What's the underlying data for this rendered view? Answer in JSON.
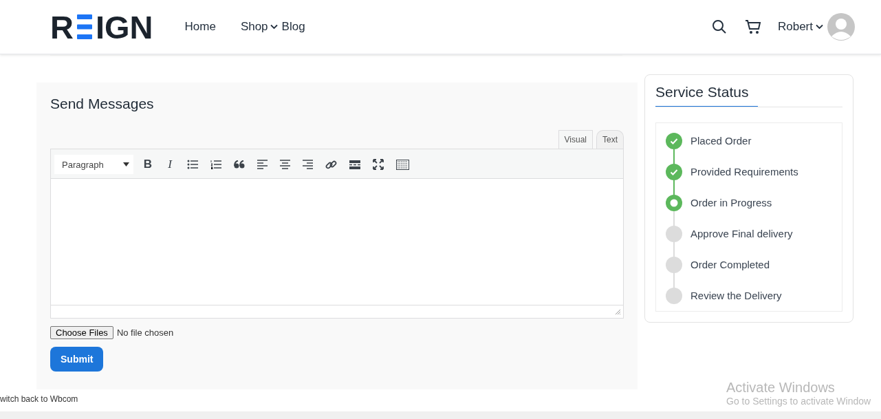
{
  "logo": {
    "before": "R",
    "after": "IGN"
  },
  "nav": [
    {
      "label": "Home",
      "dropdown": false
    },
    {
      "label": "Shop",
      "dropdown": true
    },
    {
      "label": "Blog",
      "dropdown": false
    }
  ],
  "user": {
    "name": "Robert"
  },
  "messages": {
    "title": "Send Messages",
    "tabs": [
      {
        "label": "Visual",
        "selected": true
      },
      {
        "label": "Text",
        "selected": false
      }
    ],
    "format": "Paragraph",
    "toolbar": [
      {
        "kind": "bold",
        "label": "B"
      },
      {
        "kind": "italic",
        "label": "I"
      },
      {
        "kind": "bullets"
      },
      {
        "kind": "numbers"
      },
      {
        "kind": "quote"
      },
      {
        "kind": "align-left"
      },
      {
        "kind": "align-center"
      },
      {
        "kind": "align-right"
      },
      {
        "kind": "link"
      },
      {
        "kind": "more"
      },
      {
        "kind": "fullscreen"
      },
      {
        "kind": "kitchen"
      }
    ],
    "file_button": "Choose Files",
    "file_status": "No file chosen",
    "submit": "Submit"
  },
  "status": {
    "title": "Service Status",
    "steps": [
      {
        "label": "Placed Order",
        "kind": "done"
      },
      {
        "label": "Provided Requirements",
        "kind": "done"
      },
      {
        "label": "Order in Progress",
        "kind": "current"
      },
      {
        "label": "Approve Final delivery",
        "kind": "pending"
      },
      {
        "label": "Order Completed",
        "kind": "pending"
      },
      {
        "label": "Review the Delivery",
        "kind": "pending"
      }
    ]
  },
  "footer_link": "witch back to Wbcom",
  "os_notice": {
    "title": "Activate Windows",
    "text": "Go to Settings to activate Window"
  }
}
